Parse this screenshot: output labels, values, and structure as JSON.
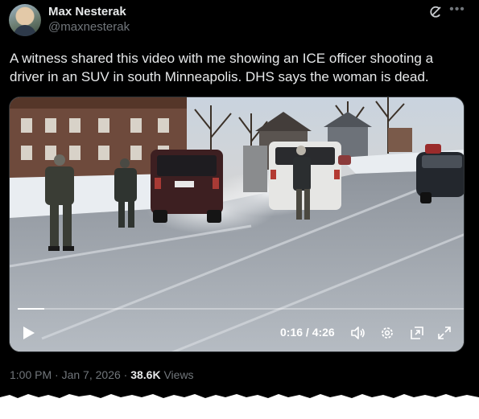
{
  "author": {
    "name": "Max Nesterak",
    "handle": "@maxnesterak"
  },
  "icons": {
    "avatar": "profile-photo",
    "grok": "grok-icon",
    "more": "more-horizontal-icon",
    "play": "play-icon",
    "volume": "volume-icon",
    "settings": "gear-icon",
    "pip": "picture-in-picture-icon",
    "fullscreen": "fullscreen-icon"
  },
  "post": {
    "text": "A witness shared this video with me showing an ICE officer shooting a driver in an SUV in south Minneapolis. DHS says the woman is dead."
  },
  "video": {
    "time_display": "0:16 / 4:26",
    "progress_fraction": 0.06
  },
  "meta": {
    "time": "1:00 PM",
    "separator": "·",
    "date": "Jan 7, 2026",
    "views_count": "38.6K",
    "views_label": "Views"
  },
  "colors": {
    "background": "#000000",
    "text_primary": "#e7e9ea",
    "text_secondary": "#71767b",
    "border": "#2f3336"
  }
}
